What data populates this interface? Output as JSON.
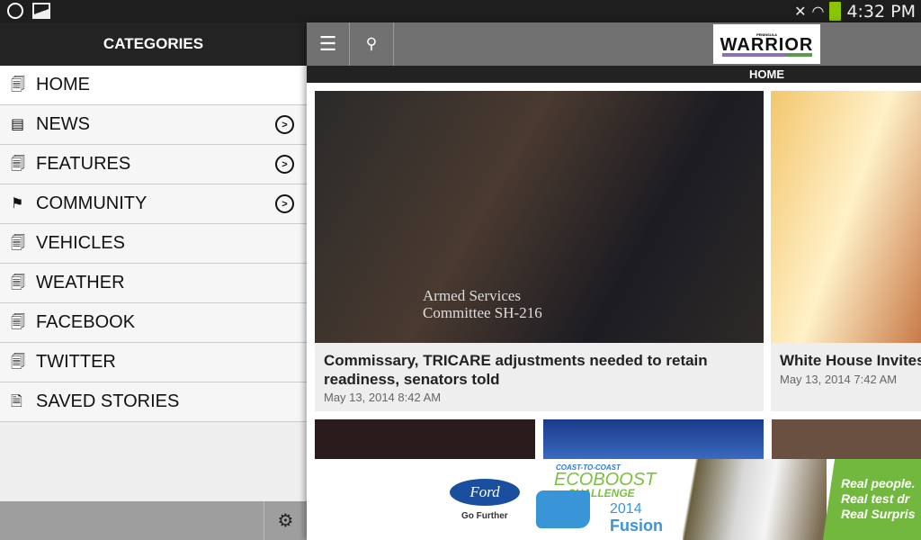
{
  "status_bar": {
    "time": "4:32 PM"
  },
  "sidebar": {
    "title": "CATEGORIES",
    "items": [
      {
        "label": "HOME",
        "expandable": false
      },
      {
        "label": "NEWS",
        "expandable": true
      },
      {
        "label": "FEATURES",
        "expandable": true
      },
      {
        "label": "COMMUNITY",
        "expandable": true
      },
      {
        "label": "VEHICLES",
        "expandable": false
      },
      {
        "label": "WEATHER",
        "expandable": false
      },
      {
        "label": "FACEBOOK",
        "expandable": false
      },
      {
        "label": "TWITTER",
        "expandable": false
      },
      {
        "label": "SAVED STORIES",
        "expandable": false
      }
    ]
  },
  "header": {
    "logo_top": "PENINSULA",
    "logo_main": "WARRIOR",
    "section": "HOME"
  },
  "articles": [
    {
      "title": "Commissary, TRICARE adjustments needed to retain readiness, senators told",
      "date": "May 13, 2014 8:42 AM",
      "image_caption": "Armed Services Committee SH-216"
    },
    {
      "title": "White House Invites",
      "date": "May 13, 2014 7:42 AM"
    }
  ],
  "ad": {
    "brand": "Ford",
    "tagline": "Go Further",
    "kicker": "COAST-TO-COAST",
    "headline1": "ECOBOOST",
    "headline2": "CHALLENGE",
    "year": "2014",
    "model": "Fusion",
    "lines": [
      "Real people.",
      "Real test dr",
      "Real Surpris"
    ]
  }
}
